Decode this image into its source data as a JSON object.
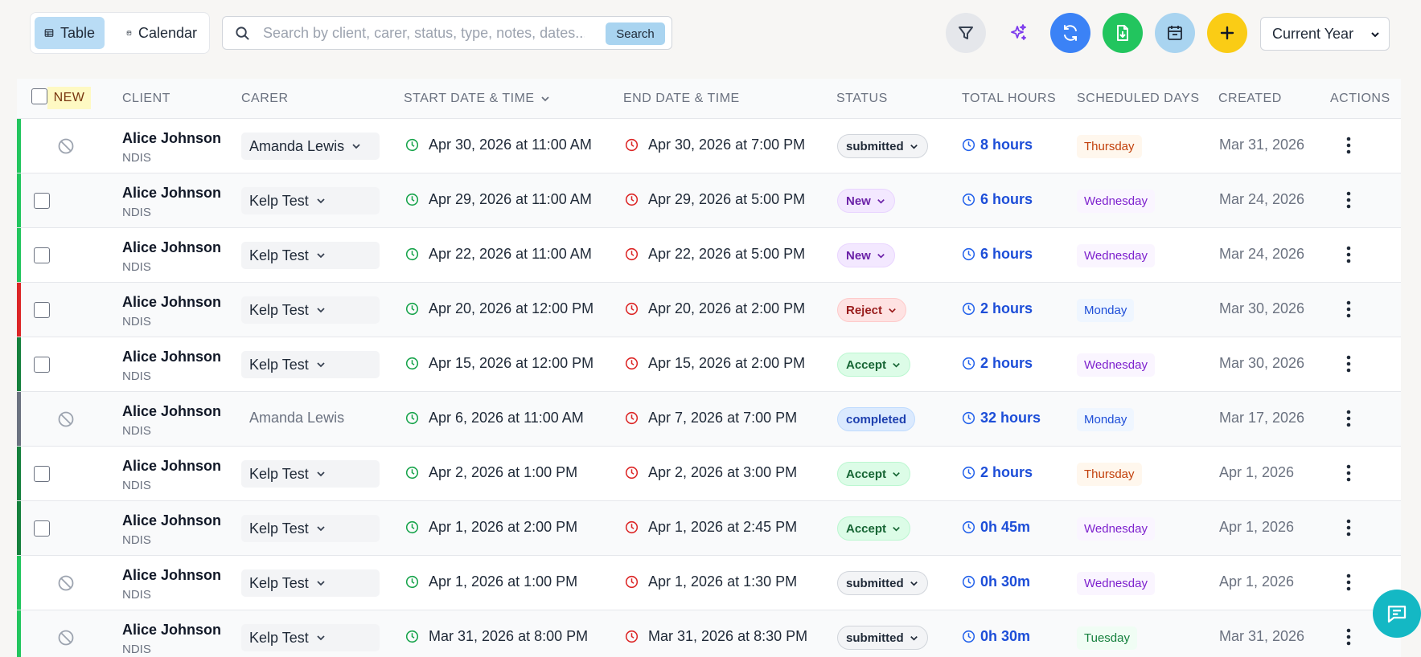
{
  "toolbar": {
    "view_table_label": "Table",
    "view_calendar_label": "Calendar",
    "search_placeholder": "Search by client, carer, status, type, notes, dates...",
    "search_button_label": "Search",
    "year_filter": "Current Year",
    "colors": {
      "filter_bg": "#e5e7eb",
      "refresh_bg": "#3b82f6",
      "export_bg": "#22c55e",
      "schedule_bg": "#a9d4f0",
      "add_bg": "#facc15"
    }
  },
  "table": {
    "headers": {
      "new": "NEW",
      "client": "CLIENT",
      "carer": "CARER",
      "start": "START DATE & TIME",
      "end": "END DATE & TIME",
      "status": "STATUS",
      "total_hours": "TOTAL HOURS",
      "scheduled_days": "SCHEDULED DAYS",
      "created": "CREATED",
      "actions": "ACTIONS"
    },
    "rows": [
      {
        "selectable": false,
        "bar": "#22c55e",
        "client": "Alice Johnson",
        "type": "NDIS",
        "carer": "Amanda Lewis",
        "carer_editable": true,
        "start": "Apr 30, 2026 at 11:00 AM",
        "end": "Apr 30, 2026 at 7:00 PM",
        "status": "submitted",
        "status_style": "submitted",
        "status_editable": true,
        "hours": "8 hours",
        "day": "Thursday",
        "day_style": "thursday",
        "created": "Mar 31, 2026"
      },
      {
        "selectable": true,
        "bar": "#22c55e",
        "client": "Alice Johnson",
        "type": "NDIS",
        "carer": "Kelp Test",
        "carer_editable": true,
        "start": "Apr 29, 2026 at 11:00 AM",
        "end": "Apr 29, 2026 at 5:00 PM",
        "status": "New",
        "status_style": "new",
        "status_editable": true,
        "hours": "6 hours",
        "day": "Wednesday",
        "day_style": "wednesday",
        "created": "Mar 24, 2026"
      },
      {
        "selectable": true,
        "bar": "#22c55e",
        "client": "Alice Johnson",
        "type": "NDIS",
        "carer": "Kelp Test",
        "carer_editable": true,
        "start": "Apr 22, 2026 at 11:00 AM",
        "end": "Apr 22, 2026 at 5:00 PM",
        "status": "New",
        "status_style": "new",
        "status_editable": true,
        "hours": "6 hours",
        "day": "Wednesday",
        "day_style": "wednesday",
        "created": "Mar 24, 2026"
      },
      {
        "selectable": true,
        "bar": "#dc2626",
        "client": "Alice Johnson",
        "type": "NDIS",
        "carer": "Kelp Test",
        "carer_editable": true,
        "start": "Apr 20, 2026 at 12:00 PM",
        "end": "Apr 20, 2026 at 2:00 PM",
        "status": "Reject",
        "status_style": "reject",
        "status_editable": true,
        "hours": "2 hours",
        "day": "Monday",
        "day_style": "monday",
        "created": "Mar 30, 2026"
      },
      {
        "selectable": true,
        "bar": "#15803d",
        "client": "Alice Johnson",
        "type": "NDIS",
        "carer": "Kelp Test",
        "carer_editable": true,
        "start": "Apr 15, 2026 at 12:00 PM",
        "end": "Apr 15, 2026 at 2:00 PM",
        "status": "Accept",
        "status_style": "accept",
        "status_editable": true,
        "hours": "2 hours",
        "day": "Wednesday",
        "day_style": "wednesday",
        "created": "Mar 30, 2026"
      },
      {
        "selectable": false,
        "bar": "#6b7280",
        "client": "Alice Johnson",
        "type": "NDIS",
        "carer": "Amanda Lewis",
        "carer_editable": false,
        "start": "Apr 6, 2026 at 11:00 AM",
        "end": "Apr 7, 2026 at 7:00 PM",
        "status": "completed",
        "status_style": "completed",
        "status_editable": false,
        "hours": "32 hours",
        "day": "Monday",
        "day_style": "monday",
        "created": "Mar 17, 2026"
      },
      {
        "selectable": true,
        "bar": "#15803d",
        "client": "Alice Johnson",
        "type": "NDIS",
        "carer": "Kelp Test",
        "carer_editable": true,
        "start": "Apr 2, 2026 at 1:00 PM",
        "end": "Apr 2, 2026 at 3:00 PM",
        "status": "Accept",
        "status_style": "accept",
        "status_editable": true,
        "hours": "2 hours",
        "day": "Thursday",
        "day_style": "thursday",
        "created": "Apr 1, 2026"
      },
      {
        "selectable": true,
        "bar": "#15803d",
        "client": "Alice Johnson",
        "type": "NDIS",
        "carer": "Kelp Test",
        "carer_editable": true,
        "start": "Apr 1, 2026 at 2:00 PM",
        "end": "Apr 1, 2026 at 2:45 PM",
        "status": "Accept",
        "status_style": "accept",
        "status_editable": true,
        "hours": "0h 45m",
        "day": "Wednesday",
        "day_style": "wednesday",
        "created": "Apr 1, 2026"
      },
      {
        "selectable": false,
        "bar": "#22c55e",
        "client": "Alice Johnson",
        "type": "NDIS",
        "carer": "Kelp Test",
        "carer_editable": true,
        "start": "Apr 1, 2026 at 1:00 PM",
        "end": "Apr 1, 2026 at 1:30 PM",
        "status": "submitted",
        "status_style": "submitted",
        "status_editable": true,
        "hours": "0h 30m",
        "day": "Wednesday",
        "day_style": "wednesday",
        "created": "Apr 1, 2026"
      },
      {
        "selectable": false,
        "bar": "#22c55e",
        "client": "Alice Johnson",
        "type": "NDIS",
        "carer": "Kelp Test",
        "carer_editable": true,
        "start": "Mar 31, 2026 at 8:00 PM",
        "end": "Mar 31, 2026 at 8:30 PM",
        "status": "submitted",
        "status_style": "submitted",
        "status_editable": true,
        "hours": "0h 30m",
        "day": "Tuesday",
        "day_style": "tuesday",
        "created": "Mar 31, 2026"
      }
    ]
  },
  "styles": {
    "status": {
      "submitted": {
        "bg": "#f3f4f6",
        "fg": "#1f2937",
        "border": "#d1d5db"
      },
      "new": {
        "bg": "#f3e8ff",
        "fg": "#6b21a8",
        "border": "#e9d5ff"
      },
      "reject": {
        "bg": "#fee2e2",
        "fg": "#991b1b",
        "border": "#fecaca"
      },
      "accept": {
        "bg": "#dcfce7",
        "fg": "#166534",
        "border": "#bbf7d0"
      },
      "completed": {
        "bg": "#dbeafe",
        "fg": "#1e40af",
        "border": "#bfdbfe"
      }
    },
    "day": {
      "thursday": {
        "bg": "#fff7ed",
        "fg": "#c2410c"
      },
      "wednesday": {
        "bg": "#faf5ff",
        "fg": "#7e22ce"
      },
      "monday": {
        "bg": "#eff6ff",
        "fg": "#1d4ed8"
      },
      "tuesday": {
        "bg": "#f0fdf4",
        "fg": "#15803d"
      }
    }
  },
  "icons": {
    "table": "table-icon",
    "calendar": "calendar-icon",
    "search": "search-icon",
    "filter": "filter-icon",
    "ai": "sparkles-icon",
    "refresh": "refresh-icon",
    "export": "file-download-icon",
    "schedule": "calendar-edit-icon",
    "add": "plus-icon",
    "chat": "chat-icon"
  }
}
